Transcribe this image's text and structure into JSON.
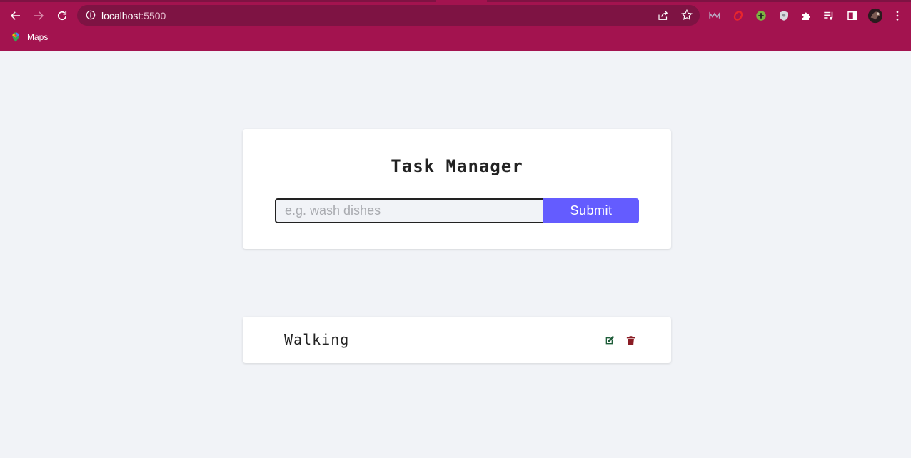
{
  "browser": {
    "url_host": "localhost",
    "url_port": ":5500",
    "bookmarks": [
      {
        "label": "Maps",
        "icon": "maps-pin-icon"
      }
    ],
    "extensions": [
      "meta-icon",
      "opera-icon",
      "plus-circle-icon",
      "shield-icon",
      "puzzle-icon",
      "playlist-icon",
      "side-panel-icon",
      "profile-avatar-icon",
      "menu-dots-icon"
    ],
    "colors": {
      "frame": "#a3134f",
      "omnibox": "#7e1343"
    }
  },
  "page": {
    "title": "Task Manager",
    "input": {
      "placeholder": "e.g. wash dishes",
      "value": ""
    },
    "submit_label": "Submit",
    "tasks": [
      {
        "name": "Walking"
      }
    ],
    "colors": {
      "background": "#f1f3f7",
      "accent": "#645cff",
      "edit": "#1f5d3a",
      "delete": "#8a1c24"
    }
  }
}
